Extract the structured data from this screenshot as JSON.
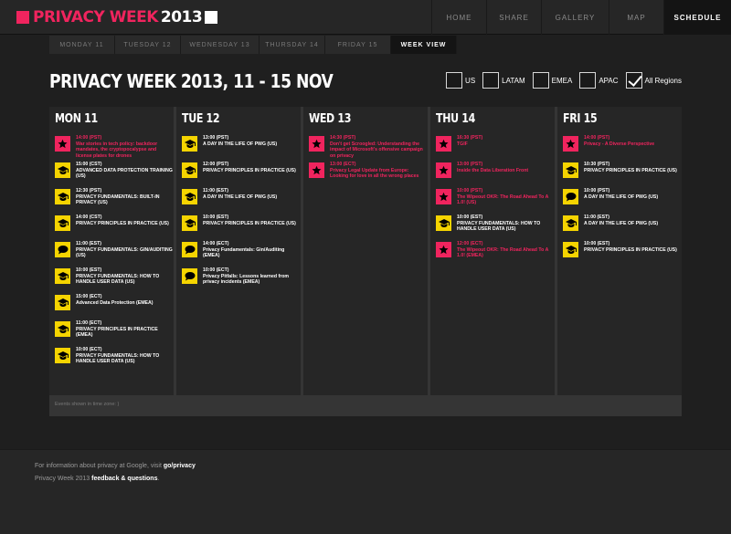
{
  "header": {
    "logo_text": "PRIVACY WEEK",
    "logo_year": "2013",
    "nav": [
      {
        "label": "HOME"
      },
      {
        "label": "SHARE"
      },
      {
        "label": "GALLERY"
      },
      {
        "label": "MAP"
      },
      {
        "label": "SCHEDULE",
        "active": true
      }
    ]
  },
  "day_tabs": [
    {
      "label": "MONDAY 11"
    },
    {
      "label": "TUESDAY 12"
    },
    {
      "label": "WEDNESDAY 13"
    },
    {
      "label": "THURSDAY 14"
    },
    {
      "label": "FRIDAY 15"
    },
    {
      "label": "WEEK VIEW",
      "active": true
    }
  ],
  "page_title": "PRIVACY WEEK 2013, 11 - 15 NOV",
  "regions": [
    {
      "label": "US",
      "checked": false
    },
    {
      "label": "LATAM",
      "checked": false
    },
    {
      "label": "EMEA",
      "checked": false
    },
    {
      "label": "APAC",
      "checked": false
    },
    {
      "label": "All Regions",
      "checked": true
    }
  ],
  "days": [
    {
      "label": "MON 11",
      "events": [
        {
          "type": "star",
          "time": "14:00 (PST)",
          "title": "War stories in tech policy: backdoor mandates, the cryptopocalypse and license plates for drones"
        },
        {
          "type": "cap",
          "time": "15:00 (CST)",
          "title": "ADVANCED DATA PROTECTION TRAINING (US)"
        },
        {
          "type": "cap",
          "time": "12:30 (PST)",
          "title": "PRIVACY FUNDAMENTALS: BUILT-IN PRIVACY (US)"
        },
        {
          "type": "cap",
          "time": "14:00 (CST)",
          "title": "PRIVACY PRINCIPLES IN PRACTICE (US)"
        },
        {
          "type": "chat",
          "time": "11:00 (EST)",
          "title": "PRIVACY FUNDAMENTALS: GIN/AUDITING (US)"
        },
        {
          "type": "cap",
          "time": "10:00 (EST)",
          "title": "PRIVACY FUNDAMENTALS: HOW TO HANDLE USER DATA (US)"
        },
        {
          "type": "cap",
          "time": "15:00 (ECT)",
          "title": "Advanced Data Protection (EMEA)"
        },
        {
          "type": "cap",
          "time": "11:00 (ECT)",
          "title": "PRIVACY PRINCIPLES IN PRACTICE (EMEA)"
        },
        {
          "type": "cap",
          "time": "10:00 (ECT)",
          "title": "PRIVACY FUNDAMENTALS: HOW TO HANDLE USER DATA (US)"
        }
      ]
    },
    {
      "label": "TUE 12",
      "events": [
        {
          "type": "cap",
          "time": "13:00 (PST)",
          "title": "A DAY IN THE LIFE OF PWG (US)"
        },
        {
          "type": "cap",
          "time": "12:00 (PST)",
          "title": "PRIVACY PRINCIPLES IN PRACTICE (US)"
        },
        {
          "type": "cap",
          "time": "11:00 (EST)",
          "title": "A DAY IN THE LIFE OF PWG (US)"
        },
        {
          "type": "cap",
          "time": "10:00 (EST)",
          "title": "PRIVACY PRINCIPLES IN PRACTICE (US)"
        },
        {
          "type": "chat",
          "time": "14:00 (ECT)",
          "title": "Privacy Fundamentals: Gin/Auditing (EMEA)"
        },
        {
          "type": "chat",
          "time": "10:00 (ECT)",
          "title": "Privacy Pitfalls: Lessons learned from privacy incidents (EMEA)"
        }
      ]
    },
    {
      "label": "WED 13",
      "events": [
        {
          "type": "star",
          "time": "14:30 (PST)",
          "title": "Don't get Scroogled: Understanding the impact of Microsoft's offensive campaign on privacy"
        },
        {
          "type": "star",
          "time": "13:00 (ECT)",
          "title": "Privacy Legal Update from Europe: Looking for love in all the wrong places"
        }
      ]
    },
    {
      "label": "THU 14",
      "events": [
        {
          "type": "star",
          "time": "16:30 (PST)",
          "title": "TGIF"
        },
        {
          "type": "star",
          "time": "13:00 (PST)",
          "title": "Inside the Data Liberation Front"
        },
        {
          "type": "star",
          "time": "10:00 (PST)",
          "title": "The Wipeout OKR: The Road Ahead To A 1.0! (US)"
        },
        {
          "type": "cap",
          "time": "10:00 (EST)",
          "title": "PRIVACY FUNDAMENTALS: HOW TO HANDLE USER DATA (US)"
        },
        {
          "type": "star",
          "time": "12:00 (ECT)",
          "title": "The Wipeout OKR: The Road Ahead To A 1.0! (EMEA)"
        }
      ]
    },
    {
      "label": "FRI 15",
      "events": [
        {
          "type": "star",
          "time": "14:00 (PST)",
          "title": "Privacy - A Diverse Perspective"
        },
        {
          "type": "cap",
          "time": "10:30 (PST)",
          "title": "PRIVACY PRINCIPLES IN PRACTICE (US)"
        },
        {
          "type": "chat",
          "time": "10:00 (PST)",
          "title": "A DAY IN THE LIFE OF PWG (US)"
        },
        {
          "type": "cap",
          "time": "11:00 (EST)",
          "title": "A DAY IN THE LIFE OF PWG (US)"
        },
        {
          "type": "cap",
          "time": "10:00 (EST)",
          "title": "PRIVACY PRINCIPLES IN PRACTICE (US)"
        }
      ]
    }
  ],
  "timezone_note": "Events shown in time zone: )",
  "footer": {
    "line1_prefix": "For information about privacy at Google, visit ",
    "line1_link": "go/privacy",
    "line2_prefix": "Privacy Week 2013 ",
    "line2_link": "feedback & questions",
    "line2_suffix": "."
  },
  "colors": {
    "accent_pink": "#f0245e",
    "accent_yellow": "#f5d400",
    "background": "#1f1f1f"
  }
}
